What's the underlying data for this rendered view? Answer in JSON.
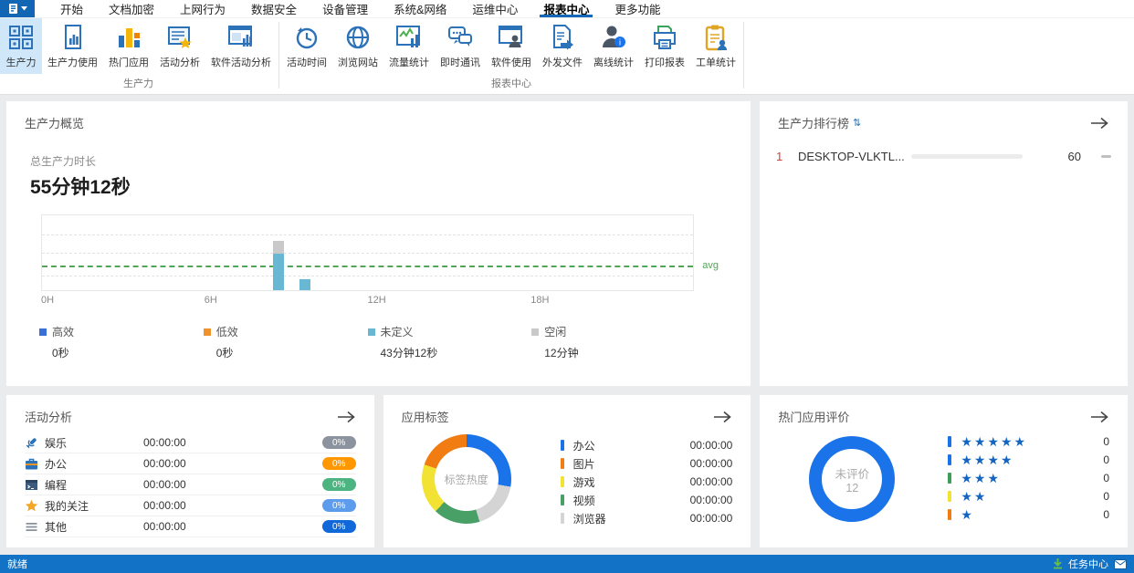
{
  "menu": {
    "items": [
      {
        "label": "开始"
      },
      {
        "label": "文档加密"
      },
      {
        "label": "上网行为"
      },
      {
        "label": "数据安全"
      },
      {
        "label": "设备管理"
      },
      {
        "label": "系统&网络"
      },
      {
        "label": "运维中心"
      },
      {
        "label": "报表中心",
        "active": true
      },
      {
        "label": "更多功能"
      }
    ]
  },
  "ribbon": {
    "groups": [
      {
        "label": "生产力",
        "buttons": [
          {
            "label": "生产力",
            "icon": "grid-icon",
            "selected": true
          },
          {
            "label": "生产力使用",
            "icon": "doc-chart-icon"
          },
          {
            "label": "热门应用",
            "icon": "bar-chart-icon"
          },
          {
            "label": "活动分析",
            "icon": "doc-star-icon"
          },
          {
            "label": "软件活动分析",
            "icon": "window-chart-icon"
          }
        ]
      },
      {
        "label": "报表中心",
        "buttons": [
          {
            "label": "活动时间",
            "icon": "clock-history-icon"
          },
          {
            "label": "浏览网站",
            "icon": "globe-icon"
          },
          {
            "label": "流量统计",
            "icon": "traffic-chart-icon"
          },
          {
            "label": "即时通讯",
            "icon": "chat-icon"
          },
          {
            "label": "软件使用",
            "icon": "window-user-icon"
          },
          {
            "label": "外发文件",
            "icon": "doc-export-icon"
          },
          {
            "label": "离线统计",
            "icon": "user-info-icon"
          },
          {
            "label": "打印报表",
            "icon": "printer-icon"
          },
          {
            "label": "工单统计",
            "icon": "clipboard-user-icon"
          }
        ]
      }
    ]
  },
  "panels": {
    "overview": {
      "title": "生产力概览",
      "total_label": "总生产力时长",
      "total_value": "55分钟12秒",
      "chart_data": {
        "type": "bar",
        "x_range_hours": [
          0,
          24
        ],
        "x_ticks": [
          {
            "label": "0H",
            "hour": 0
          },
          {
            "label": "6H",
            "hour": 6
          },
          {
            "label": "12H",
            "hour": 12
          },
          {
            "label": "18H",
            "hour": 18
          }
        ],
        "ylim_minutes": [
          0,
          70
        ],
        "grid": true,
        "series": [
          {
            "name": "高效",
            "color": "#3a6fd8",
            "total": "0秒",
            "points": []
          },
          {
            "name": "低效",
            "color": "#f0932b",
            "total": "0秒",
            "points": []
          },
          {
            "name": "未定义",
            "color": "#68b7d3",
            "total": "43分钟12秒",
            "points": [
              {
                "hour": 8,
                "minutes": 33
              },
              {
                "hour": 9,
                "minutes": 10.2
              }
            ]
          },
          {
            "name": "空闲",
            "color": "#c9c9c9",
            "total": "12分钟",
            "points": [
              {
                "hour": 8,
                "minutes": 12
              }
            ]
          }
        ],
        "avg_line": {
          "label": "avg",
          "value_minutes": 21,
          "color": "#52a557"
        }
      }
    },
    "ranking": {
      "title": "生产力排行榜",
      "rows": [
        {
          "rank": "1",
          "name": "DESKTOP-VLKTL...",
          "score": "60",
          "progress_pct": 75,
          "trend": "flat"
        }
      ]
    },
    "activity": {
      "title": "活动分析",
      "rows": [
        {
          "icon": "microphone-icon",
          "name": "娱乐",
          "time": "00:00:00",
          "percent": "0%",
          "badge_color": "#8b949e"
        },
        {
          "icon": "briefcase-icon",
          "name": "办公",
          "time": "00:00:00",
          "percent": "0%",
          "badge_color": "#ff9800"
        },
        {
          "icon": "code-window-icon",
          "name": "编程",
          "time": "00:00:00",
          "percent": "0%",
          "badge_color": "#4db380"
        },
        {
          "icon": "star-icon",
          "name": "我的关注",
          "time": "00:00:00",
          "percent": "0%",
          "badge_color": "#5d9cec"
        },
        {
          "icon": "menu-icon",
          "name": "其他",
          "time": "00:00:00",
          "percent": "0%",
          "badge_color": "#1168d9"
        }
      ]
    },
    "app_tags": {
      "title": "应用标签",
      "chart_data": {
        "type": "pie",
        "center_label": "标签热度",
        "slices": [
          {
            "name": "办公",
            "time": "00:00:00",
            "color": "#1a73e8",
            "arc_deg": 100
          },
          {
            "name": "图片",
            "time": "00:00:00",
            "color": "#f07c12",
            "arc_deg": 71
          },
          {
            "name": "游戏",
            "time": "00:00:00",
            "color": "#f2e234",
            "arc_deg": 65
          },
          {
            "name": "视频",
            "time": "00:00:00",
            "color": "#49a066",
            "arc_deg": 61
          },
          {
            "name": "浏览器",
            "time": "00:00:00",
            "color": "#d4d4d4",
            "arc_deg": 63
          }
        ],
        "draw_order": [
          "办公",
          "浏览器",
          "视频",
          "游戏",
          "图片"
        ]
      }
    },
    "ratings": {
      "title": "热门应用评价",
      "center_label": "未评价",
      "center_value": "12",
      "ring_color": "#1a73e8",
      "rows": [
        {
          "stars": 5,
          "color": "#1a73e8",
          "count": "0"
        },
        {
          "stars": 4,
          "color": "#1a73e8",
          "count": "0"
        },
        {
          "stars": 3,
          "color": "#3d9e57",
          "count": "0"
        },
        {
          "stars": 2,
          "color": "#f2e234",
          "count": "0"
        },
        {
          "stars": 1,
          "color": "#f07c12",
          "count": "0"
        }
      ]
    }
  },
  "statusbar": {
    "ready": "就绪",
    "task_center": "任务中心"
  }
}
